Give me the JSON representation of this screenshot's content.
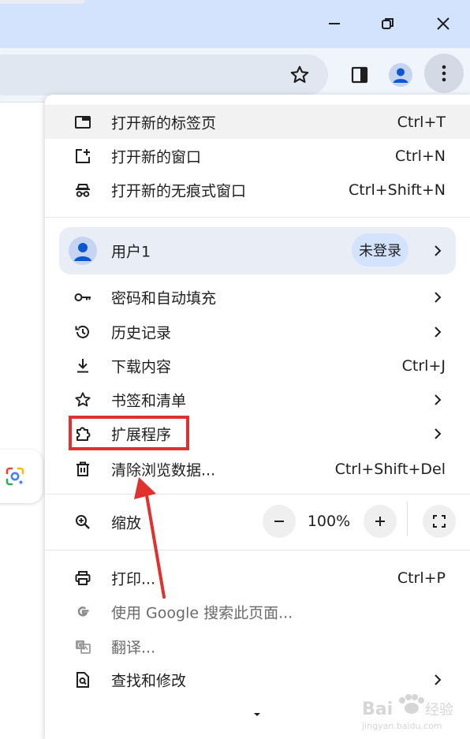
{
  "window": {
    "controls": [
      "minimize",
      "restore",
      "close"
    ],
    "colors": {
      "titlebar": "#d3e3fd",
      "toolbar": "#f0f4fb",
      "accent": "#0b57d0",
      "highlight_box": "#e0312f"
    }
  },
  "toolbar": {
    "icons": [
      "bookmark-star-icon",
      "side-panel-icon",
      "profile-avatar-icon",
      "more-menu-icon"
    ]
  },
  "menu": {
    "new_items": [
      {
        "label": "打开新的标签页",
        "shortcut": "Ctrl+T",
        "icon": "new-tab-icon"
      },
      {
        "label": "打开新的窗口",
        "shortcut": "Ctrl+N",
        "icon": "new-window-icon"
      },
      {
        "label": "打开新的无痕式窗口",
        "shortcut": "Ctrl+Shift+N",
        "icon": "incognito-icon"
      }
    ],
    "profile": {
      "name": "用户1",
      "status": "未登录"
    },
    "main_items": [
      {
        "label": "密码和自动填充",
        "shortcut": "",
        "submenu": true,
        "icon": "key-icon"
      },
      {
        "label": "历史记录",
        "shortcut": "",
        "submenu": true,
        "icon": "history-icon"
      },
      {
        "label": "下载内容",
        "shortcut": "Ctrl+J",
        "submenu": false,
        "icon": "download-icon"
      },
      {
        "label": "书签和清单",
        "shortcut": "",
        "submenu": true,
        "icon": "star-icon"
      },
      {
        "label": "扩展程序",
        "shortcut": "",
        "submenu": true,
        "icon": "extension-icon"
      },
      {
        "label": "清除浏览数据...",
        "shortcut": "Ctrl+Shift+Del",
        "submenu": false,
        "icon": "trash-icon"
      }
    ],
    "zoom": {
      "label": "缩放",
      "value": "100%"
    },
    "bottom_items": [
      {
        "label": "打印...",
        "shortcut": "Ctrl+P",
        "submenu": false,
        "disabled": false,
        "icon": "print-icon"
      },
      {
        "label": "使用 Google 搜索此页面...",
        "shortcut": "",
        "submenu": false,
        "disabled": true,
        "icon": "google-icon"
      },
      {
        "label": "翻译...",
        "shortcut": "",
        "submenu": false,
        "disabled": true,
        "icon": "translate-icon"
      },
      {
        "label": "查找和修改",
        "shortcut": "",
        "submenu": true,
        "disabled": false,
        "icon": "find-icon"
      }
    ]
  },
  "annotation": {
    "highlighted_item": "扩展程序"
  },
  "watermark": {
    "brand": "Baidu经验",
    "url": "jingyan.baidu.com"
  }
}
